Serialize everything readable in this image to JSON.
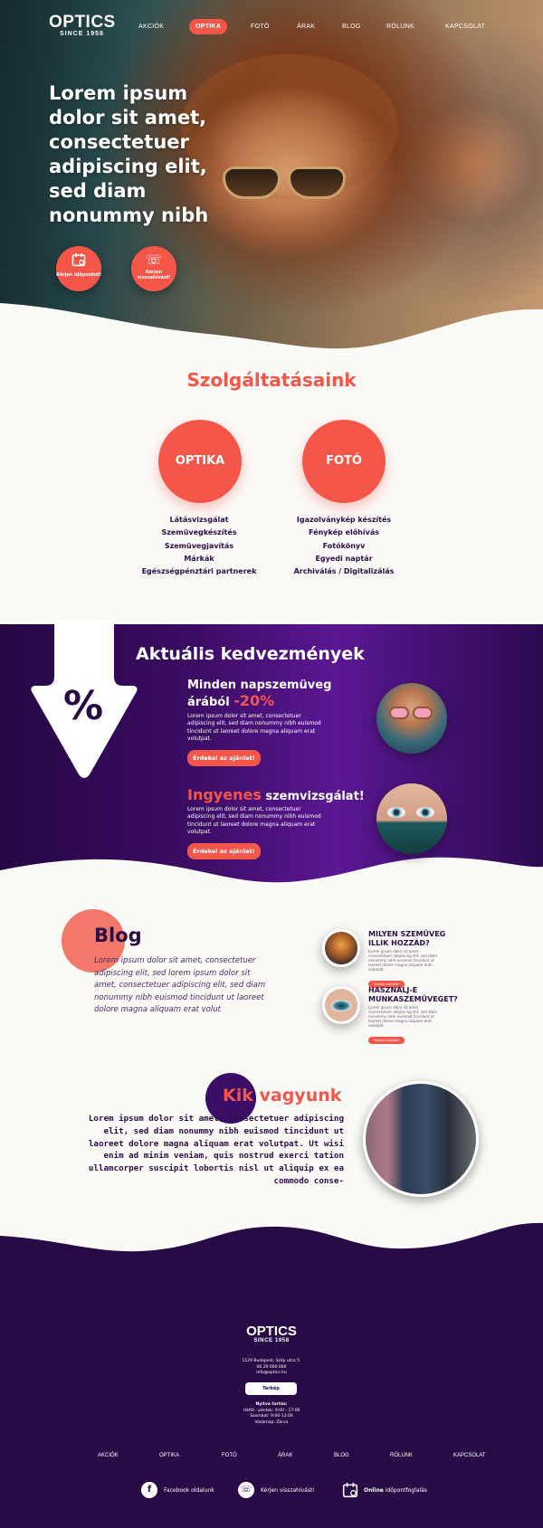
{
  "header": {
    "logo_title": "OPTICS",
    "logo_sub": "SINCE 1958",
    "nav": [
      "AKCIÓK",
      "OPTIKA",
      "FOTÓ",
      "ÁRAK",
      "BLOG",
      "RÓLUNK",
      "KAPCSOLAT"
    ],
    "active_nav": "OPTIKA"
  },
  "hero": {
    "title": "Lorem ipsum dolor sit amet, consectetuer adipiscing elit, sed diam nonummy nibh",
    "btn1": "Kérjen időpontot!",
    "btn2": "Kérjen visszahívást!"
  },
  "services": {
    "title": "Szolgáltatásaink",
    "optika": {
      "label": "OPTIKA",
      "items": [
        "Látásvizsgálat",
        "Szemüvegkészítés",
        "Szemüvegjavítás",
        "Márkák",
        "Egészségpénztári partnerek"
      ]
    },
    "foto": {
      "label": "FOTÓ",
      "items": [
        "Igazolványkép készítés",
        "Fénykép előhívás",
        "Fotókönyv",
        "Egyedi naptár",
        "Archiválás / Digitalizálás"
      ]
    }
  },
  "promo": {
    "title": "Aktuális kedvezmények",
    "symbol": "%",
    "offer1": {
      "line1": "Minden napszemüveg",
      "line2": "árából",
      "highlight": "-20%",
      "text": "Lorem ipsum dolor sit amet, consectetuer adipiscing elit, sed diam nonummy nibh euismod tincidunt ut laoreet dolore magna aliquam erat volutpat.",
      "button": "Érdekel az ajánlat!"
    },
    "offer2": {
      "highlight": "Ingyenes",
      "rest": "szemvizsgálat!",
      "text": "Lorem ipsum dolor sit amet, consectetuer adipiscing elit, sed diam nonummy nibh euismod tincidunt ut laoreet dolore magna aliquam erat volutpat.",
      "button": "Érdekel az ajánlat!"
    }
  },
  "blog": {
    "title": "Blog",
    "text": "Lorem ipsum dolor sit amet, consectetuer adipiscing elit, sed lorem ipsum dolor sit amet, consectetuer adipiscing elit, sed diam nonummy nibh euismod tincidunt ut laoreet dolore magna aliquam erat volut",
    "items": [
      {
        "title": "MILYEN SZEMÜVEG ILLIK HOZZÁD?",
        "text": "Lorem ipsum dolor sit amet, consectetuer adipiscing elit, sed diam nonummy nibh euismod tincidunt ut laoreet dolore magna aliquam erat volutpat.",
        "button": "Tovább olvasok!"
      },
      {
        "title": "HASZNÁLJ-E MUNKASZEMÜVEGET?",
        "text": "Lorem ipsum dolor sit amet, consectetuer adipiscing elit, sed diam nonummy nibh euismod tincidunt ut laoreet dolore magna aliquam erat volutpat.",
        "button": "Tovább olvasok!"
      }
    ]
  },
  "about": {
    "title_part1": "Kik",
    "title_part2": "vagyunk",
    "text": "Lorem ipsum dolor sit amet, consectetuer adipiscing elit, sed diam nonummy nibh euismod tincidunt ut laoreet dolore magna aliquam erat volutpat. Ut wisi enim ad minim veniam, quis nostrud exerci tation ullamcorper suscipit lobortis nisl ut aliquip ex ea commodo conse-"
  },
  "footer": {
    "logo_title": "OPTICS",
    "logo_sub": "SINCE 1958",
    "address": "1129 Budapest, Szép utca 5.",
    "phone": "06 29 000 000",
    "email": "info@optics.hu",
    "button": "Térkép",
    "hours_title": "Nyitva tartás:",
    "hours1": "Hétfő - péntek: 9:00 - 17:00",
    "hours2": "Szombat: 9:00-13:00",
    "hours3": "Vasárnap: Zárva",
    "nav": [
      "AKCIÓK",
      "OPTIKA",
      "FOTÓ",
      "ÁRAK",
      "BLOG",
      "RÓLUNK",
      "KAPCSOLAT"
    ],
    "cta1": "Facebook oldalunk",
    "cta2": "Kérjen visszahívást!",
    "cta3_bold": "Online",
    "cta3_rest": " időpontfoglalás"
  },
  "colors": {
    "accent": "#f4574a",
    "purple_dark": "#280a47",
    "cream": "#fbfaf7"
  }
}
